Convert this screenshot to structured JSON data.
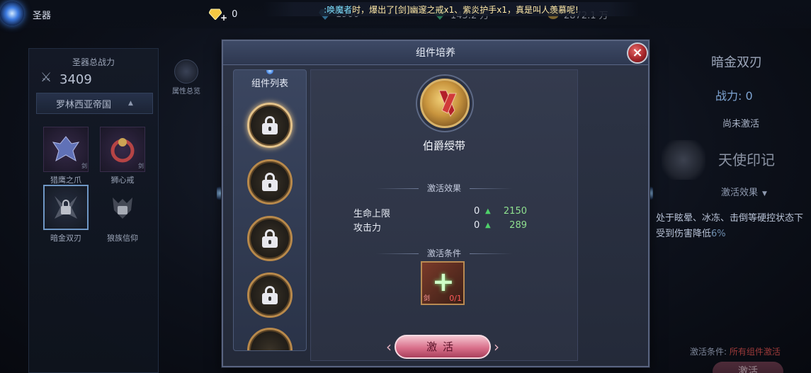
{
  "app": {
    "title": "圣器"
  },
  "currencies": [
    {
      "icon": "gold-diamond-icon",
      "value": "0"
    },
    {
      "icon": "blue-gem-icon",
      "value": "1900"
    },
    {
      "icon": "green-gem-icon",
      "value": "145.2 万"
    },
    {
      "icon": "gold-coin-icon",
      "value": "2872.1 万"
    }
  ],
  "marquee": {
    "pre": ":唤魔者",
    "body": "时，爆出了",
    "item": "[剑]幽邃之戒x1、",
    "item2": "紫炎护手x1，真是叫人羡慕呢!"
  },
  "left_panel": {
    "title": "圣器总战力",
    "power": "3409",
    "empire": "罗林西亚帝国",
    "items": [
      {
        "label": "猎鹰之爪",
        "tag": "剑"
      },
      {
        "label": "狮心戒",
        "tag": "剑"
      },
      {
        "label": "暗金双刃",
        "tag": ""
      },
      {
        "label": "狼族信仰",
        "tag": ""
      }
    ],
    "attr_button": "属性总览"
  },
  "modal": {
    "title": "组件培养",
    "close": "×",
    "list_title": "组件列表",
    "item_name": "伯爵绶带",
    "effect_title": "激活效果",
    "stats": [
      {
        "name": "生命上限",
        "current": "0",
        "next": "2150"
      },
      {
        "name": "攻击力",
        "current": "0",
        "next": "289"
      }
    ],
    "condition_title": "激活条件",
    "requirement": {
      "tag": "剑",
      "count": "0/1"
    },
    "activate_label": "激活"
  },
  "right_panel": {
    "name": "暗金双刃",
    "power": "战力: 0",
    "status": "尚未激活",
    "seal_name": "天使印记",
    "effect_title": "激活效果",
    "desc1": "处于眩晕、冰冻、击倒等硬控状态下",
    "desc2": "受到伤害降低",
    "desc_pct": "6%",
    "condition_label": "激活条件: ",
    "condition_value": "所有组件激活",
    "button": "激活"
  },
  "colors": {
    "accent_gold": "#d8b36a",
    "stat_up": "#4fd16a",
    "button_pink": "#d9708b",
    "close_red": "#a5262b"
  }
}
